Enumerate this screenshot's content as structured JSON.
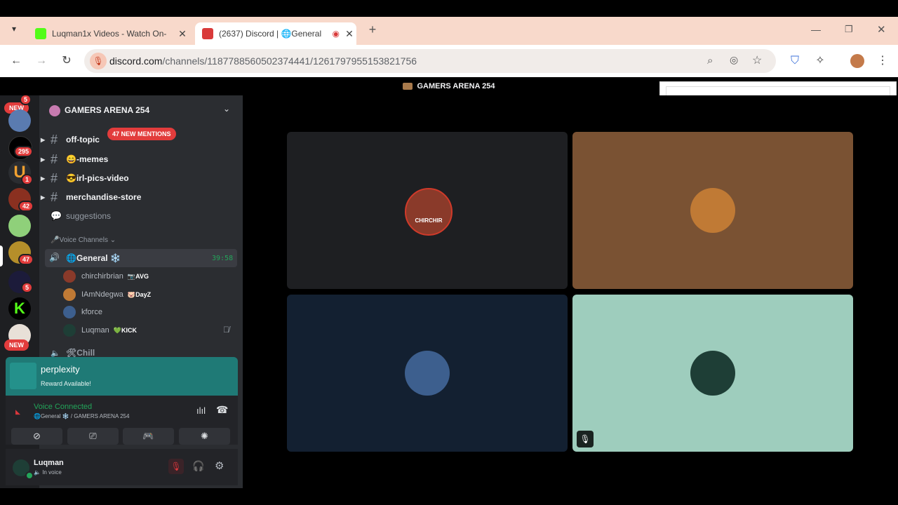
{
  "browser": {
    "tabs": [
      {
        "title": "Luqman1x Videos - Watch On-",
        "favicon_color": "#53fc18",
        "active": false
      },
      {
        "title": "(2637) Discord | 🌐General ",
        "favicon_color": "#d93a3a",
        "active": true
      }
    ],
    "url_domain": "discord.com",
    "url_path": "/channels/1187788560502374441/1261797955153821756",
    "new_tab": "+"
  },
  "discord": {
    "top_title": "GAMERS ARENA 254",
    "server_name": "GAMERS ARENA 254",
    "rail_badges": [
      "5",
      "295",
      "1",
      "42",
      "47",
      "5"
    ],
    "rail_new_label": "NEW",
    "new_mentions": "47 NEW MENTIONS",
    "channels": [
      {
        "name": "off-topic",
        "bright": true
      },
      {
        "name": "😄-memes",
        "bright": true
      },
      {
        "name": "😎irl-pics-video",
        "bright": true
      },
      {
        "name": "merchandise-store",
        "bright": true
      },
      {
        "name": "suggestions",
        "bright": false
      }
    ],
    "voice_category": "🎤Voice Channels",
    "voice_channel": {
      "name": "🌐General ❄️",
      "timer": "39:58"
    },
    "voice_users": [
      {
        "name": "chirchirbrian",
        "tag": "AVG",
        "tag_icon": "📷"
      },
      {
        "name": "IAmNdegwa",
        "tag": "DayZ",
        "tag_icon": "🐷"
      },
      {
        "name": "kforce",
        "tag": "",
        "tag_icon": ""
      },
      {
        "name": "Luqman",
        "tag": "KICK",
        "tag_icon": "💚"
      }
    ],
    "next_channel": "🛠Chill",
    "promo": {
      "title": "perplexity",
      "subtitle": "Reward Available!"
    },
    "voice_connected": {
      "status": "Voice Connected",
      "location": "🌐General ❄️ / GAMERS ARENA 254"
    },
    "user": {
      "name": "Luqman",
      "status": "In voice"
    },
    "tiles": [
      {
        "bg": "#1e1f22",
        "avatar": "#8a3a2a"
      },
      {
        "bg": "#7a5233",
        "avatar": "#c07a35"
      },
      {
        "bg": "#132031",
        "avatar": "#3d5f8e"
      },
      {
        "bg": "#9ecdbd",
        "avatar": "#1e3e36"
      }
    ],
    "avatar_text": "CHIRCHIR"
  }
}
